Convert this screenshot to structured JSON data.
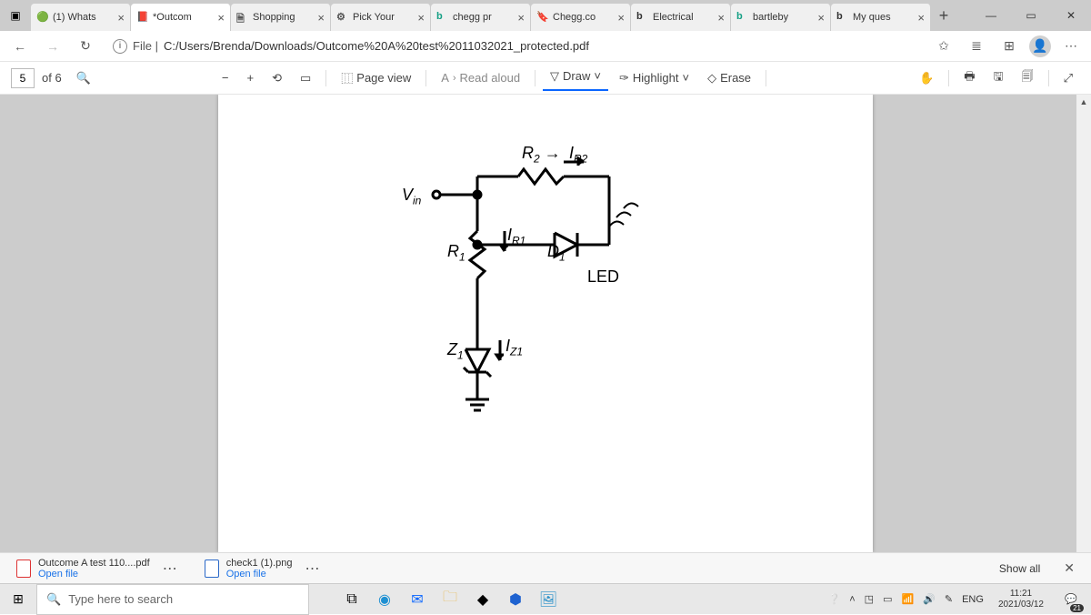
{
  "tabs": [
    {
      "label": "(1) Whats",
      "icon": "🟢"
    },
    {
      "label": "*Outcom",
      "icon": "📕",
      "active": true
    },
    {
      "label": "Shopping",
      "icon": "🗎"
    },
    {
      "label": "Pick Your",
      "icon": "⚙"
    },
    {
      "label": "chegg pr",
      "icon": "b",
      "iconColor": "#16a085"
    },
    {
      "label": "Chegg.co",
      "icon": "🔖"
    },
    {
      "label": "Electrical",
      "icon": "b",
      "iconColor": "#333"
    },
    {
      "label": "bartleby",
      "icon": "b",
      "iconColor": "#16a085"
    },
    {
      "label": "My ques",
      "icon": "b",
      "iconColor": "#333"
    }
  ],
  "window": {
    "min": "—",
    "max": "▭",
    "close": "✕"
  },
  "addr": {
    "file_lbl": "File",
    "path": "C:/Users/Brenda/Downloads/Outcome%20A%20test%2011032021_protected.pdf"
  },
  "pdfbar": {
    "page": "5",
    "of": "of 6",
    "pageview": "Page view",
    "readaloud": "Read aloud",
    "draw": "Draw",
    "highlight": "Highlight",
    "erase": "Erase"
  },
  "circuit": {
    "Vin": "V",
    "Vin_sub": "in",
    "R2": "R",
    "R2_sub": "2",
    "IR2": "I",
    "IR2_sub": "R2",
    "R1": "R",
    "R1_sub": "1",
    "IR1": "I",
    "IR1_sub": "R1",
    "D1": "D",
    "D1_sub": "1",
    "LED": "LED",
    "Z1": "Z",
    "Z1_sub": "1",
    "IZ1": "I",
    "IZ1_sub": "Z1"
  },
  "downloads": [
    {
      "name": "Outcome A test 110....pdf",
      "open": "Open file",
      "type": "pdf"
    },
    {
      "name": "check1 (1).png",
      "open": "Open file",
      "type": "img"
    }
  ],
  "showall": "Show all",
  "taskbar": {
    "search": "Type here to search",
    "lang": "ENG",
    "time": "11:21",
    "date": "2021/03/12",
    "notif": "21"
  }
}
